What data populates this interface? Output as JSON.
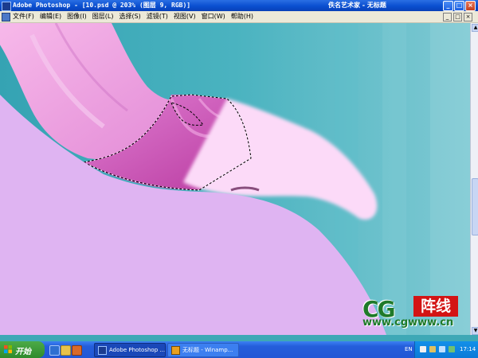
{
  "window": {
    "title": "Adobe Photoshop - [10.psd @ 203% (图层 9, RGB)]",
    "right_title": "佚名艺术家 - 无标题",
    "controls": [
      "_",
      "□",
      "×"
    ]
  },
  "menu": {
    "items": [
      "文件(F)",
      "编辑(E)",
      "图像(I)",
      "图层(L)",
      "选择(S)",
      "滤镜(T)",
      "视图(V)",
      "窗口(W)",
      "帮助(H)"
    ],
    "mdi_controls": [
      "_",
      "□",
      "×"
    ]
  },
  "logo": {
    "cg": "CG",
    "cn": "阵线",
    "url": "www.cgwww.cn"
  },
  "taskbar": {
    "start_label": "开始",
    "tasks": [
      {
        "label": "Adobe Photoshop ...",
        "icon": "photoshop-icon",
        "active": true
      },
      {
        "label": "无标题 - Winamp...",
        "icon": "winamp-icon",
        "active": false
      }
    ],
    "language": "EN",
    "clock": "17:14"
  },
  "colors": {
    "teal_background": "#3ea8b6",
    "skin_pink": "#fbd8f7",
    "lilac_body": "#dfb4f2",
    "sleeve_magenta": "#d969c8",
    "xp_blue": "#245edb",
    "start_green": "#3a9a35",
    "logo_red": "#d31414",
    "logo_green": "#1f7a2a"
  }
}
